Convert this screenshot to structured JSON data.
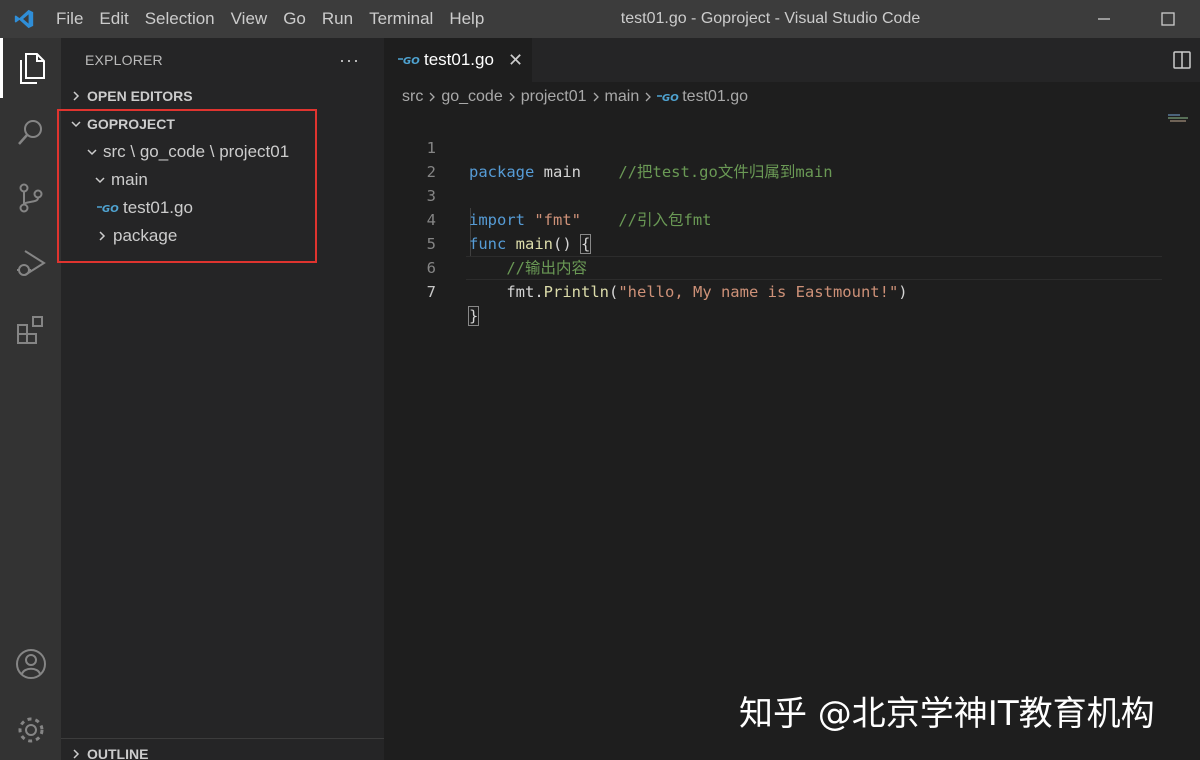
{
  "titlebar": {
    "menu": [
      "File",
      "Edit",
      "Selection",
      "View",
      "Go",
      "Run",
      "Terminal",
      "Help"
    ],
    "title": "test01.go - Goproject - Visual Studio Code"
  },
  "activity": {
    "items": [
      "explorer-icon",
      "search-icon",
      "source-control-icon",
      "run-debug-icon",
      "extensions-icon"
    ],
    "bottom": [
      "account-icon",
      "settings-gear-icon"
    ]
  },
  "sidebar": {
    "title": "EXPLORER",
    "more": "···",
    "open_editors": "OPEN EDITORS",
    "project": "GOPROJECT",
    "tree": {
      "folder": "src \\ go_code \\ project01",
      "main": "main",
      "file": "test01.go",
      "package": "package"
    },
    "outline": "OUTLINE"
  },
  "editor": {
    "tab": {
      "label": "test01.go",
      "close": "✕"
    },
    "breadcrumbs": [
      "src",
      "go_code",
      "project01",
      "main",
      "test01.go"
    ],
    "line_numbers": [
      "1",
      "2",
      "3",
      "4",
      "5",
      "6",
      "7"
    ],
    "code": {
      "l1_kw": "package",
      "l1_id": " main",
      "l1_cm": "    //把test.go文件归属到main",
      "l3_kw": "import",
      "l3_str": " \"fmt\"",
      "l3_cm": "    //引入包fmt",
      "l4_kw": "func",
      "l4_fn": " main",
      "l4_rest": "() ",
      "l4_brace": "{",
      "l5_cm": "    //输出内容",
      "l6_id": "    fmt.",
      "l6_fn": "Println",
      "l6_p1": "(",
      "l6_str": "\"hello, My name is Eastmount!\"",
      "l6_p2": ")",
      "l7_brace": "}"
    }
  },
  "watermark": "知乎 @北京学神IT教育机构",
  "colors": {
    "activity": "#333333",
    "sidebar": "#252526",
    "editor": "#1e1e1e",
    "highlight": "#e0342f",
    "keyword": "#569cd6",
    "string": "#ce9178",
    "comment": "#6a9955",
    "function": "#dcdcaa"
  }
}
